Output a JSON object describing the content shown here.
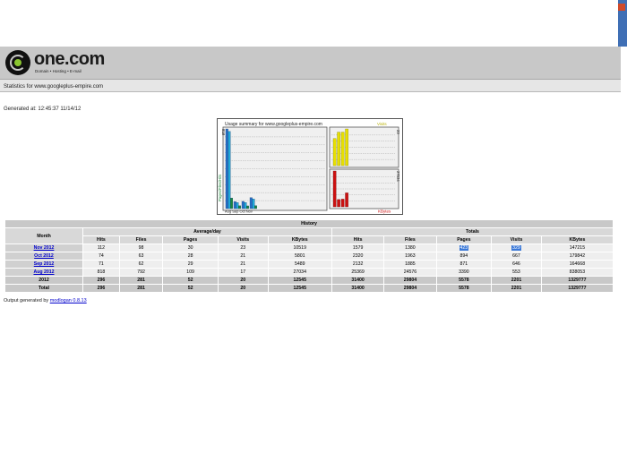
{
  "window": {
    "title": "",
    "edge_color": "#3f6fb5"
  },
  "banner": {
    "brand": "one.com",
    "tagline": "Domain • Hosting • E-mail"
  },
  "page": {
    "stats_for": "Statistics for www.googleplus-empire.com",
    "generated": "Generated at: 12:45:37 11/14/12",
    "footer_prefix": "Output generated by",
    "footer_link": "modlogan 0.8.13"
  },
  "chart_data": {
    "type": "bar",
    "title": "Usage summary for www.googleplus-empire.com",
    "categories": [
      "Aug",
      "Sep",
      "Oct",
      "Nov"
    ],
    "xtick_text": "Aug Sep Oct Nov",
    "left_panel": {
      "ylabel_max": "818",
      "ylabel": "Pages/Files/Hits",
      "series": [
        {
          "name": "Hits",
          "color": "#2a6fc9",
          "values": [
            818,
            71,
            74,
            112
          ]
        },
        {
          "name": "Files",
          "color": "#20a8d8",
          "values": [
            792,
            62,
            63,
            98
          ]
        },
        {
          "name": "Pages",
          "color": "#1c8a3c",
          "values": [
            109,
            29,
            28,
            30
          ]
        }
      ]
    },
    "visits_panel": {
      "label": "Visits",
      "ymax_label": "23",
      "color": "#e8e000",
      "values": [
        17,
        21,
        21,
        23
      ]
    },
    "kbytes_panel": {
      "label": "KBytes",
      "ymax_label": "27034",
      "color": "#cc1111",
      "values": [
        27034,
        5489,
        5801,
        10519
      ]
    }
  },
  "history": {
    "title": "History",
    "group_avg": "Average/day",
    "group_totals": "Totals",
    "month_header": "Month",
    "cols": [
      "Hits",
      "Files",
      "Pages",
      "Visits",
      "KBytes",
      "Hits",
      "Files",
      "Pages",
      "Visits",
      "KBytes"
    ],
    "rows": [
      {
        "month": "Nov 2012",
        "vals": [
          "112",
          "98",
          "30",
          "23",
          "10519",
          "1579",
          "1380",
          "423",
          "329",
          "147215"
        ]
      },
      {
        "month": "Oct 2012",
        "vals": [
          "74",
          "63",
          "28",
          "21",
          "5801",
          "2320",
          "1963",
          "894",
          "667",
          "179842"
        ]
      },
      {
        "month": "Sep 2012",
        "vals": [
          "71",
          "62",
          "29",
          "21",
          "5489",
          "2132",
          "1885",
          "871",
          "646",
          "164668"
        ]
      },
      {
        "month": "Aug 2012",
        "vals": [
          "818",
          "792",
          "109",
          "17",
          "27034",
          "25369",
          "24576",
          "3390",
          "553",
          "838053"
        ]
      }
    ],
    "year_row": {
      "label": "2012",
      "vals": [
        "296",
        "281",
        "52",
        "20",
        "12545",
        "31400",
        "29804",
        "5578",
        "2201",
        "1329777"
      ]
    },
    "total_row": {
      "label": "Total",
      "vals": [
        "296",
        "281",
        "52",
        "20",
        "12545",
        "31400",
        "29804",
        "5578",
        "2201",
        "1329777"
      ]
    }
  }
}
